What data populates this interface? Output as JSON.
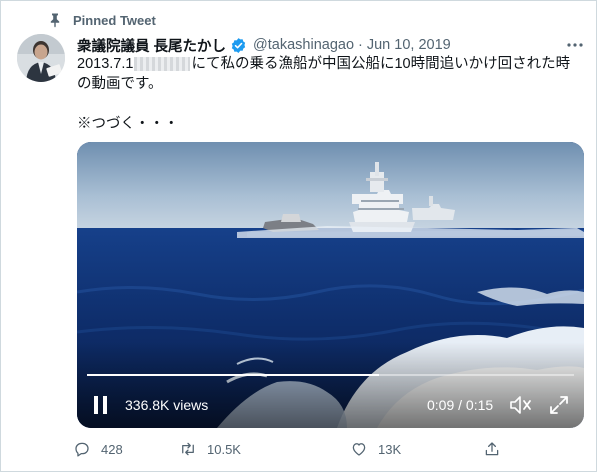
{
  "pinned": {
    "label": "Pinned Tweet",
    "icon": "pin-icon"
  },
  "tweet": {
    "display_name": "衆議院議員 長尾たかし",
    "handle": "@takashinagao",
    "separator": "·",
    "date": "Jun 10, 2019",
    "more_icon": "more-icon",
    "text_line1_a": "2013.7.1",
    "text_line1_b": "にて私の乗る漁船が中国公船に10時間追いかけ回された時",
    "text_line2": "の動画です。",
    "text_line3": "※つづく・・・"
  },
  "video": {
    "views": "336.8K views",
    "time": "0:09 / 0:15",
    "progress": 0.6
  },
  "actions": {
    "reply_count": "428",
    "retweet_count": "10.5K",
    "like_count": "13K",
    "share_icon": "share-icon"
  },
  "colors": {
    "accent": "#1d9bf0",
    "muted": "#536471",
    "text": "#0f1419"
  }
}
